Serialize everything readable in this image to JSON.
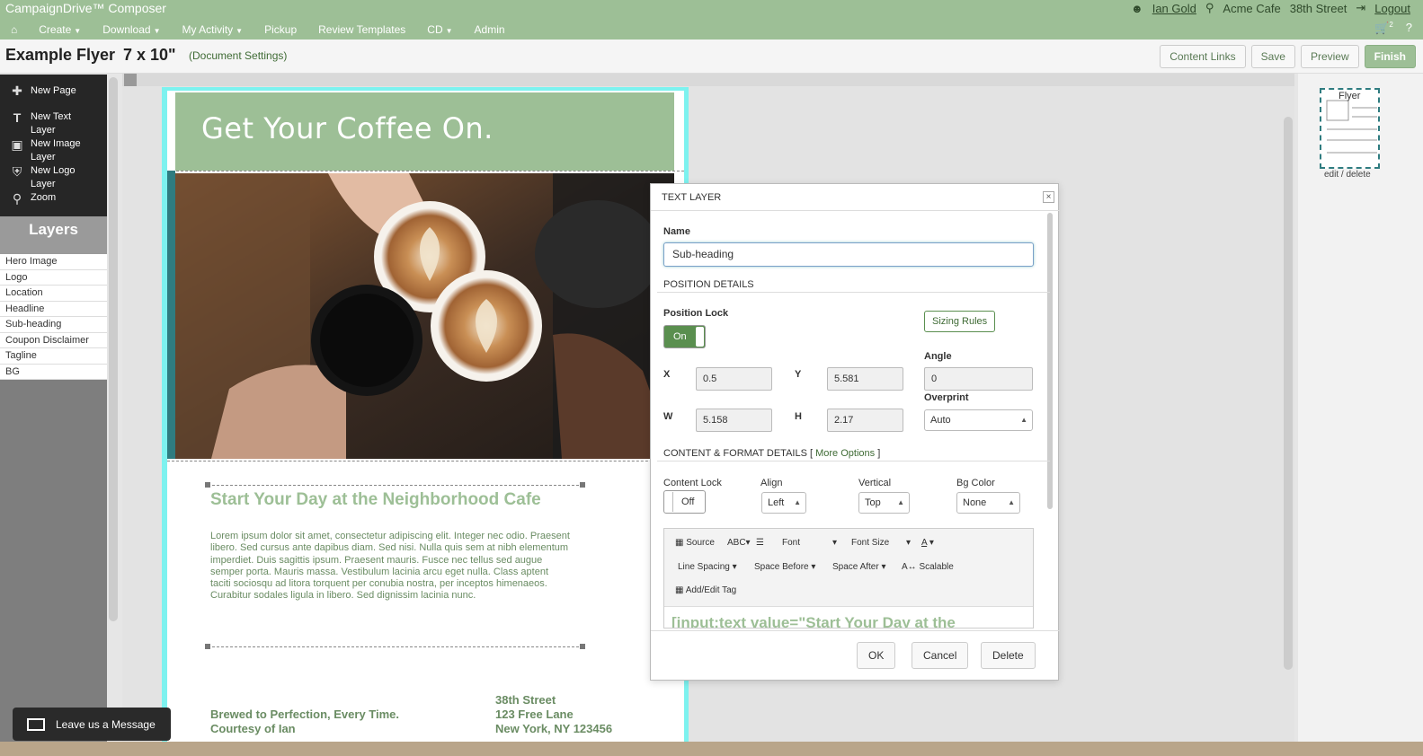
{
  "app": {
    "title": "CampaignDrive™ Composer",
    "user": "Ian Gold",
    "location1": "Acme Cafe",
    "location2": "38th Street",
    "logout": "Logout",
    "cart_count": "2",
    "help": "?"
  },
  "nav": {
    "home_icon": "home-icon",
    "items": [
      {
        "label": "Create",
        "caret": true
      },
      {
        "label": "Download",
        "caret": true
      },
      {
        "label": "My Activity",
        "caret": true
      },
      {
        "label": "Pickup",
        "caret": false
      },
      {
        "label": "Review Templates",
        "caret": false
      },
      {
        "label": "CD",
        "caret": true
      },
      {
        "label": "Admin",
        "caret": false
      }
    ]
  },
  "doc": {
    "title": "Example Flyer",
    "size": "7 x 10\"",
    "settings_link": "(Document Settings)",
    "buttons": {
      "content_links": "Content Links",
      "save": "Save",
      "preview": "Preview",
      "finish": "Finish"
    }
  },
  "tools": [
    {
      "icon": "plus-icon",
      "label": "New Page"
    },
    {
      "icon": "text-icon",
      "label": "New Text Layer"
    },
    {
      "icon": "image-icon",
      "label": "New Image Layer"
    },
    {
      "icon": "shield-icon",
      "label": "New Logo Layer"
    },
    {
      "icon": "zoom-icon",
      "label": "Zoom"
    }
  ],
  "layers": {
    "heading": "Layers",
    "items": [
      "Hero Image",
      "Logo",
      "Location",
      "Headline",
      "Sub-heading",
      "Coupon Disclaimer",
      "Tagline",
      "BG"
    ]
  },
  "flyer": {
    "headline": "Get Your Coffee On.",
    "subheading": "Start Your Day at the Neighborhood Cafe",
    "body": "Lorem ipsum dolor sit amet, consectetur adipiscing elit. Integer nec odio. Praesent libero. Sed cursus ante dapibus diam. Sed nisi. Nulla quis sem at nibh elementum imperdiet. Duis sagittis ipsum. Praesent mauris. Fusce nec tellus sed augue semper porta. Mauris massa. Vestibulum lacinia arcu eget nulla. Class aptent taciti sociosqu ad litora torquent per conubia nostra, per inceptos himenaeos. Curabitur sodales ligula in libero. Sed dignissim lacinia nunc.",
    "tagline_line1": "Brewed to Perfection, Every Time.",
    "tagline_line2": "Courtesy of Ian",
    "location_line1": "38th Street",
    "location_line2": "123 Free Lane",
    "location_line3": "New York, NY 123456"
  },
  "thumbnails": {
    "label": "Flyer",
    "actions": "edit / delete"
  },
  "dialog": {
    "title": "TEXT LAYER",
    "name_label": "Name",
    "name_value": "Sub-heading",
    "position_section": "POSITION DETAILS",
    "position_lock_label": "Position Lock",
    "position_lock_value": "On",
    "sizing_rules": "Sizing Rules",
    "x_label": "X",
    "x_value": "0.5",
    "y_label": "Y",
    "y_value": "5.581",
    "w_label": "W",
    "w_value": "5.158",
    "h_label": "H",
    "h_value": "2.17",
    "angle_label": "Angle",
    "angle_value": "0",
    "overprint_label": "Overprint",
    "overprint_value": "Auto",
    "content_section": "CONTENT & FORMAT DETAILS [",
    "more_options": "More Options",
    "content_section_end": "]",
    "content_lock_label": "Content Lock",
    "content_lock_value": "Off",
    "align_label": "Align",
    "align_value": "Left",
    "vertical_label": "Vertical",
    "vertical_value": "Top",
    "bgcolor_label": "Bg Color",
    "bgcolor_value": "None",
    "editor": {
      "source": "Source",
      "font": "Font",
      "font_size": "Font Size",
      "line_spacing": "Line Spacing",
      "space_before": "Space Before",
      "space_after": "Space After",
      "scalable": "Scalable",
      "add_edit_tag": "Add/Edit Tag",
      "content_preview": "[input:text value=\"Start Your Day at the"
    },
    "ok": "OK",
    "cancel": "Cancel",
    "delete": "Delete"
  },
  "message_widget": {
    "label": "Leave us a Message"
  },
  "colors": {
    "brand_green": "#9dbf96",
    "bleed_cyan": "#7df2ef",
    "dark_teal": "#2f7c80"
  }
}
